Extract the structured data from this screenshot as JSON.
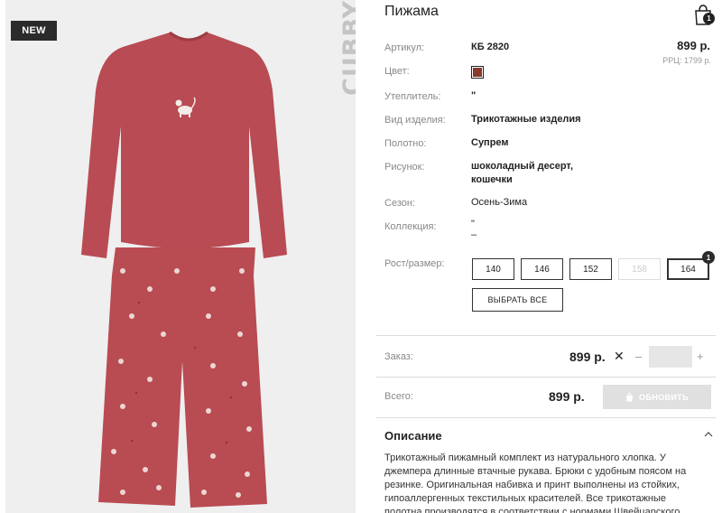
{
  "badge": "NEW",
  "brand": "CUBBY",
  "product": {
    "title": "Пижама",
    "price": "899 р.",
    "rrp": "РРЦ: 1799 р.",
    "color_hex": "#8a3a2c",
    "attributes": [
      {
        "label": "Артикул:",
        "value": "КБ 2820"
      },
      {
        "label": "Цвет:",
        "value": ""
      },
      {
        "label": "Утеплитель:",
        "value": "\""
      },
      {
        "label": "Вид изделия:",
        "value": "Трикотажные изделия"
      },
      {
        "label": "Полотно:",
        "value": "Супрем"
      },
      {
        "label": "Рисунок:",
        "value_line1": "шоколадный десерт,",
        "value_line2": "кошечки"
      },
      {
        "label": "Сезон:",
        "value": "Осень-Зима"
      },
      {
        "label": "Коллекция:",
        "value_line1": "\"",
        "value_line2": "–"
      }
    ]
  },
  "cart": {
    "count": "1"
  },
  "sizes": {
    "label": "Рост/размер:",
    "options": [
      "140",
      "146",
      "152",
      "158",
      "164"
    ],
    "selected": "164",
    "disabled": [
      "158"
    ],
    "selected_count": "1",
    "select_all_label": "ВЫБРАТЬ ВСЕ"
  },
  "order": {
    "label": "Заказ:",
    "price": "899 р.",
    "remove_symbol": "✕",
    "minus": "–",
    "plus": "+",
    "quantity": ""
  },
  "total": {
    "label": "Всего:",
    "price": "899 р.",
    "update_label": "ОБНОВИТЬ"
  },
  "description": {
    "title": "Описание",
    "text": "Трикотажный пижамный комплект из натурального хлопка. У джемпера длинные втачные рукава. Брюки с удобным поясом на резинке. Оригинальная набивка и принт выполнены из стойких, гипоаллергенных текстильных красителей. Все трикотажные полотна производятся в соответствии с нормами Швейцарского"
  },
  "icons": {
    "cart": "shopping-bag-icon",
    "chevron": "chevron-up-icon",
    "update": "cart-icon"
  }
}
